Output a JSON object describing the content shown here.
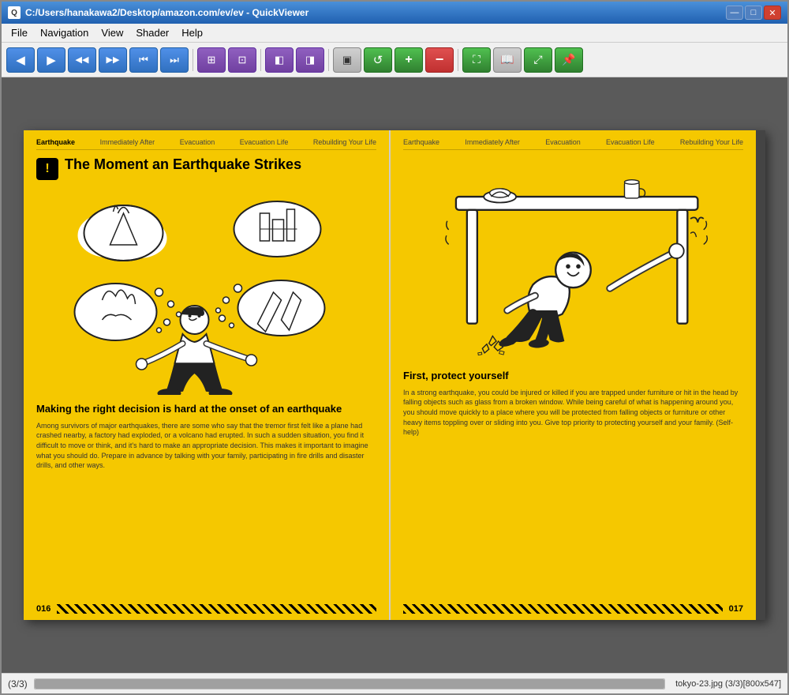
{
  "window": {
    "title": "C:/Users/hanakawa2/Desktop/amazon.com/ev/ev - QuickViewer",
    "icon_label": "Q"
  },
  "title_controls": {
    "minimize": "—",
    "maximize": "□",
    "close": "✕"
  },
  "menu": {
    "items": [
      "File",
      "Navigation",
      "View",
      "Shader",
      "Help"
    ]
  },
  "toolbar": {
    "buttons": [
      {
        "id": "prev-blue",
        "icon": "◀",
        "color": "blue",
        "label": "Previous"
      },
      {
        "id": "play-blue",
        "icon": "▶",
        "color": "blue",
        "label": "Play"
      },
      {
        "id": "prev-fast",
        "icon": "◀◀",
        "color": "blue",
        "label": "Fast Previous"
      },
      {
        "id": "next-fast",
        "icon": "▶▶",
        "color": "blue",
        "label": "Fast Next"
      },
      {
        "id": "first",
        "icon": "⏮",
        "color": "blue",
        "label": "First"
      },
      {
        "id": "last",
        "icon": "⏭",
        "color": "blue",
        "label": "Last"
      },
      {
        "id": "sep1",
        "type": "separator"
      },
      {
        "id": "fit-width",
        "icon": "⊞",
        "color": "purple",
        "label": "Fit Width"
      },
      {
        "id": "fit-window",
        "icon": "⊡",
        "color": "purple",
        "label": "Fit Window"
      },
      {
        "id": "sep2",
        "type": "separator"
      },
      {
        "id": "left-page",
        "icon": "◧",
        "color": "purple",
        "label": "Left Page"
      },
      {
        "id": "right-page",
        "icon": "◨",
        "color": "purple",
        "label": "Right Page"
      },
      {
        "id": "sep3",
        "type": "separator"
      },
      {
        "id": "spread",
        "icon": "▣",
        "color": "gray-active",
        "label": "Spread"
      },
      {
        "id": "refresh",
        "icon": "↺",
        "color": "green",
        "label": "Refresh"
      },
      {
        "id": "zoom-in",
        "icon": "＋",
        "color": "green",
        "label": "Zoom In"
      },
      {
        "id": "zoom-out",
        "icon": "－",
        "color": "red",
        "label": "Zoom Out"
      },
      {
        "id": "sep4",
        "type": "separator"
      },
      {
        "id": "fullscreen",
        "icon": "⛶",
        "color": "green",
        "label": "Fullscreen"
      },
      {
        "id": "book-mode",
        "icon": "📖",
        "color": "gray-active",
        "label": "Book Mode"
      },
      {
        "id": "fit-all",
        "icon": "⤢",
        "color": "green",
        "label": "Fit All"
      },
      {
        "id": "pin",
        "icon": "📌",
        "color": "green",
        "label": "Pin"
      }
    ]
  },
  "pages": {
    "nav_tabs": [
      "Earthquake",
      "Immediately After",
      "Evacuation",
      "Evacuation Life",
      "Rebuilding Your Life"
    ],
    "left": {
      "page_number": "016",
      "title": "The Moment an Earthquake Strikes",
      "caption_title": "Making the right decision is hard at the onset of an earthquake",
      "caption_text": "Among survivors of major earthquakes, there are some who say that the tremor first felt like a plane had crashed nearby, a factory had exploded, or a volcano had erupted. In such a sudden situation, you find it difficult to move or think, and it's hard to make an appropriate decision. This makes it important to imagine what you should do. Prepare in advance by talking with your family, participating in fire drills and disaster drills, and other ways."
    },
    "right": {
      "page_number": "017",
      "title": "First, protect yourself",
      "caption_text": "In a strong earthquake, you could be injured or killed if you are trapped under furniture or hit in the head by falling objects such as glass from a broken window. While being careful of what is happening around you, you should move quickly to a place where you will be protected from falling objects or furniture or other heavy items toppling over or sliding into you. Give top priority to protecting yourself and your family. (Self-help)"
    }
  },
  "status_bar": {
    "page_indicator": "(3/3)",
    "file_info": "tokyo-23.jpg (3/3)[800x547]",
    "progress_percent": 100
  }
}
